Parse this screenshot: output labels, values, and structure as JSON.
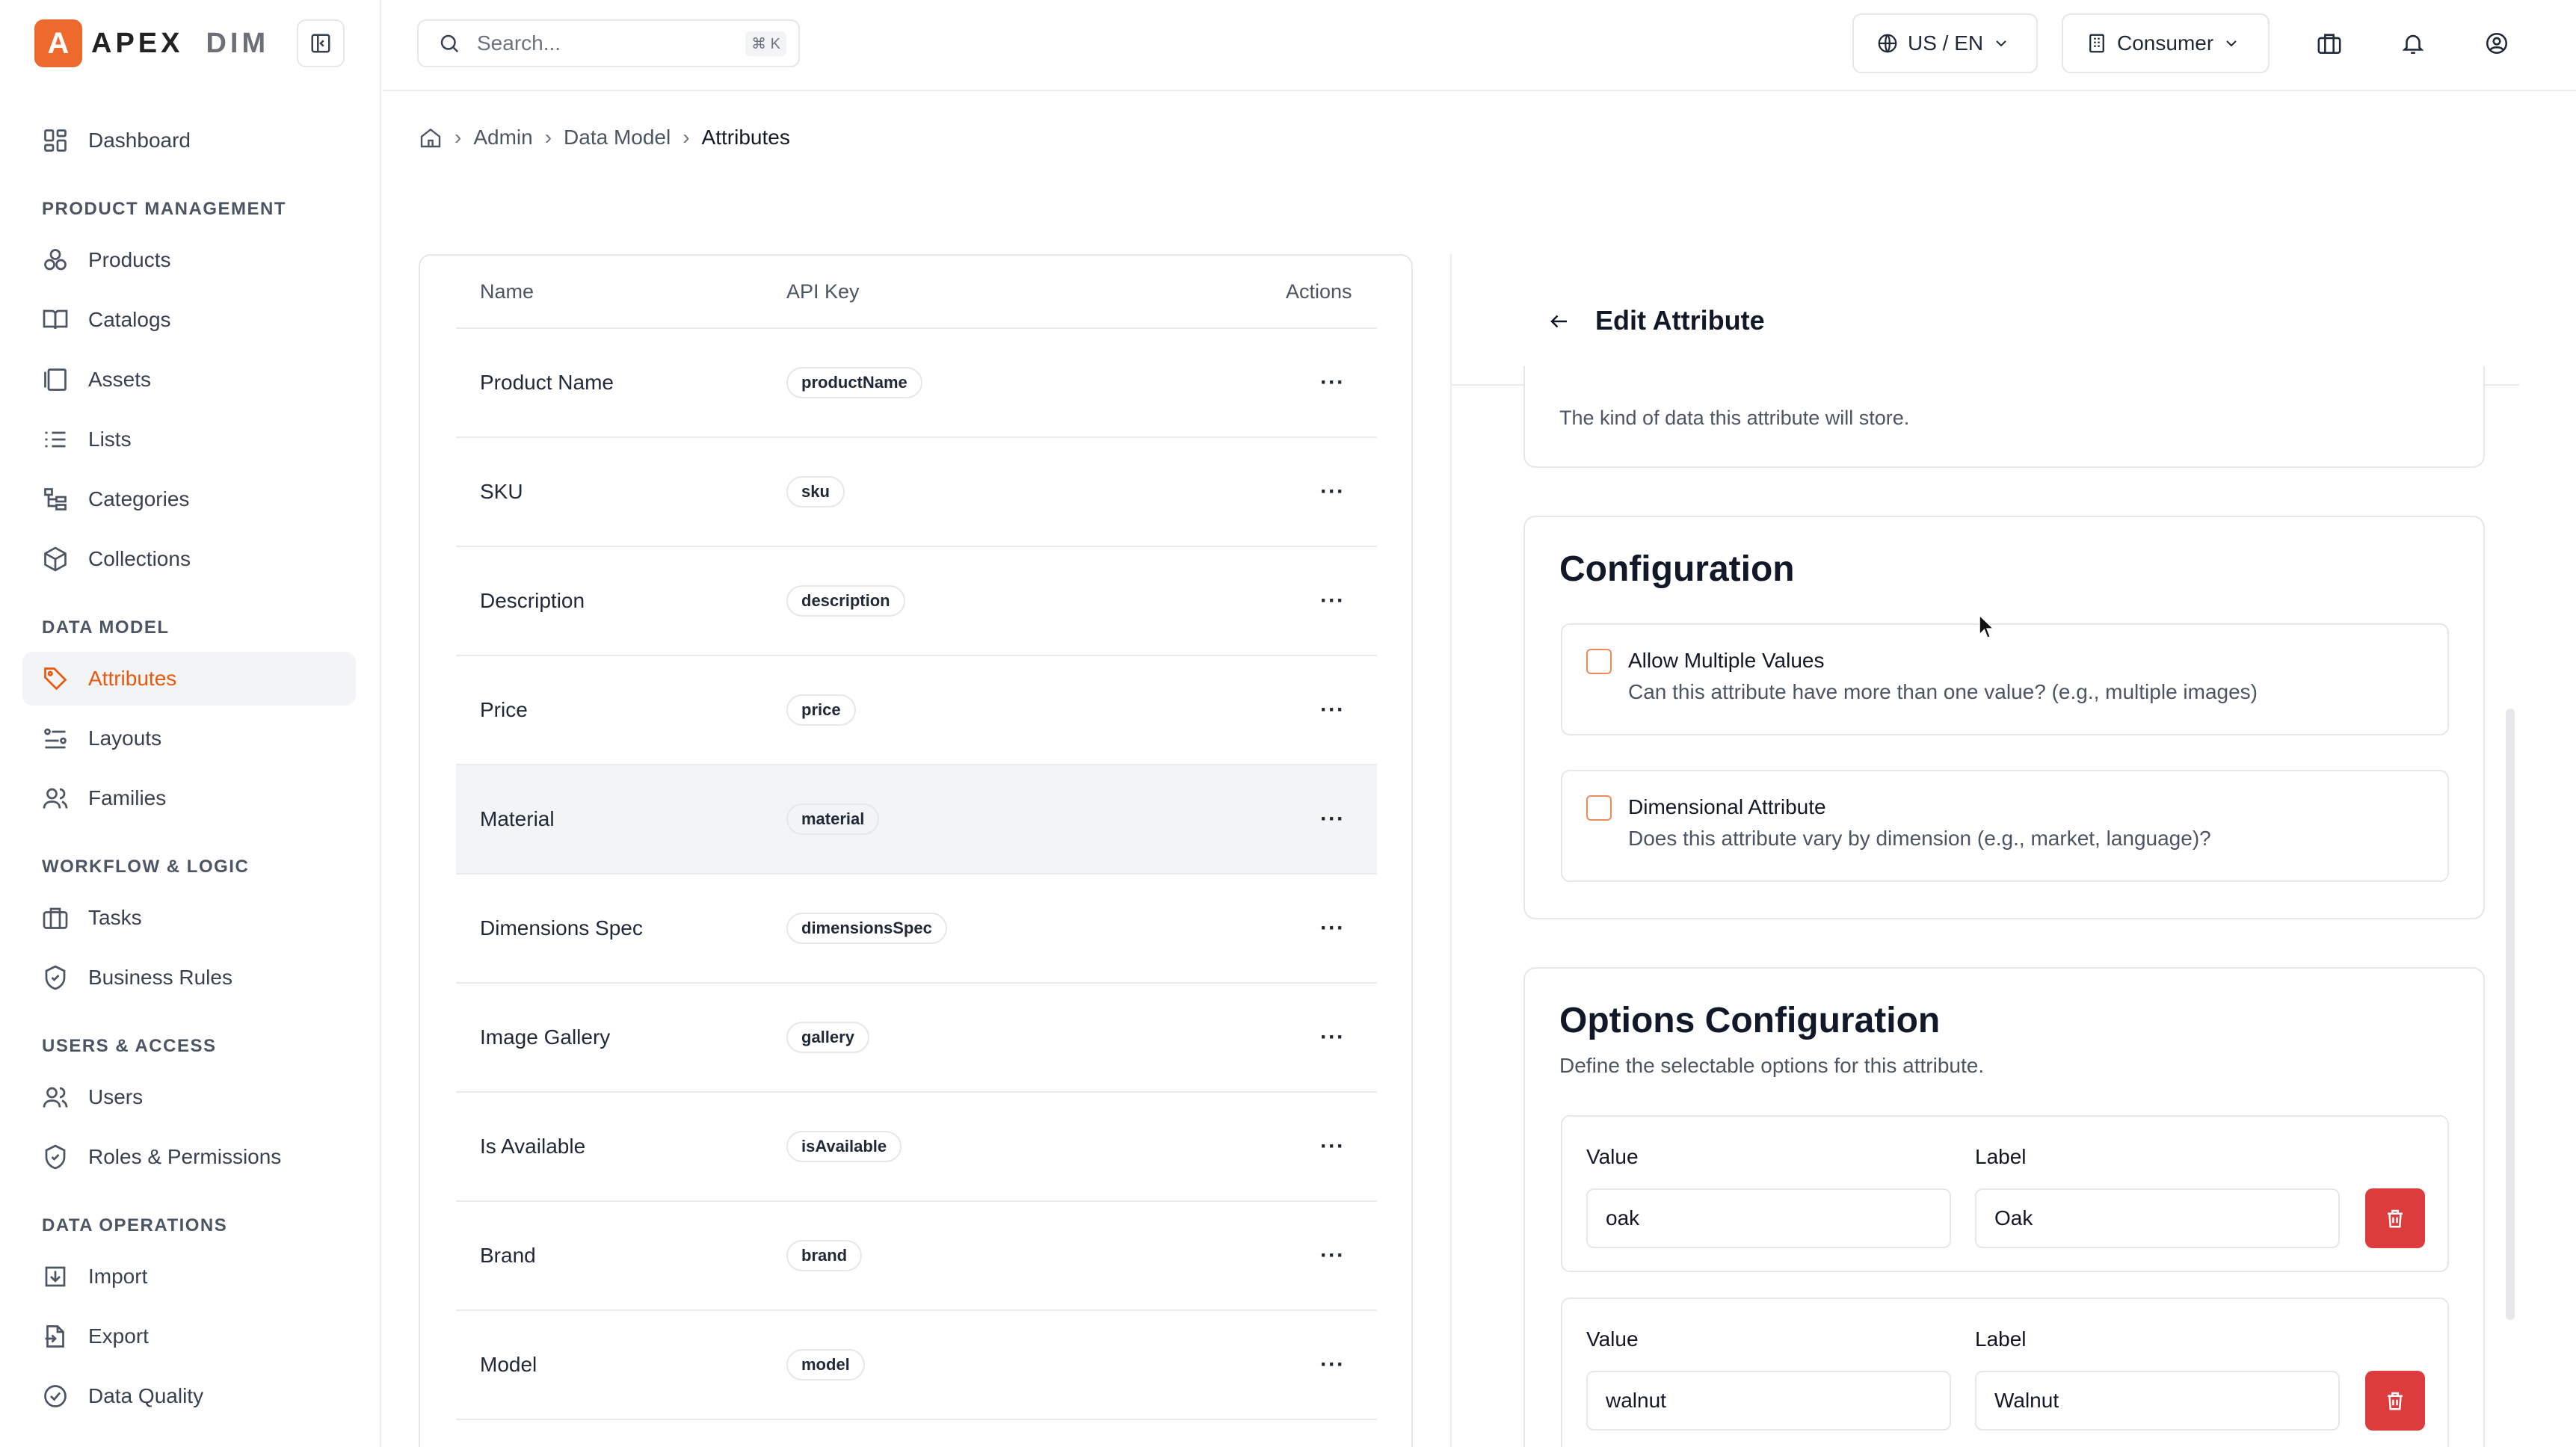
{
  "app": {
    "logo_letter": "A",
    "logo_text": "APEX",
    "logo_suffix": "DIM",
    "accent": "#ee6a2c"
  },
  "sidebar": {
    "dashboard": "Dashboard",
    "sections": [
      {
        "title": "PRODUCT MANAGEMENT",
        "items": [
          {
            "label": "Products",
            "icon": "products-icon"
          },
          {
            "label": "Catalogs",
            "icon": "book-icon"
          },
          {
            "label": "Assets",
            "icon": "assets-icon"
          },
          {
            "label": "Lists",
            "icon": "list-icon"
          },
          {
            "label": "Categories",
            "icon": "tree-icon"
          },
          {
            "label": "Collections",
            "icon": "box-icon"
          }
        ]
      },
      {
        "title": "DATA MODEL",
        "items": [
          {
            "label": "Attributes",
            "icon": "tag-icon",
            "active": true
          },
          {
            "label": "Layouts",
            "icon": "layout-icon"
          },
          {
            "label": "Families",
            "icon": "users-icon"
          }
        ]
      },
      {
        "title": "WORKFLOW & LOGIC",
        "items": [
          {
            "label": "Tasks",
            "icon": "briefcase-icon"
          },
          {
            "label": "Business Rules",
            "icon": "shield-icon"
          }
        ]
      },
      {
        "title": "USERS & ACCESS",
        "items": [
          {
            "label": "Users",
            "icon": "users-icon"
          },
          {
            "label": "Roles & Permissions",
            "icon": "shield-icon"
          }
        ]
      },
      {
        "title": "DATA OPERATIONS",
        "items": [
          {
            "label": "Import",
            "icon": "import-icon"
          },
          {
            "label": "Export",
            "icon": "export-icon"
          },
          {
            "label": "Data Quality",
            "icon": "check-circle-icon"
          }
        ]
      }
    ]
  },
  "topbar": {
    "search_placeholder": "Search...",
    "search_shortcut": "⌘ K",
    "locale": "US / EN",
    "channel": "Consumer"
  },
  "breadcrumb": {
    "items": [
      "Admin",
      "Data Model"
    ],
    "current": "Attributes"
  },
  "table": {
    "headers": {
      "name": "Name",
      "key": "API Key",
      "actions": "Actions"
    },
    "rows": [
      {
        "name": "Product Name",
        "key": "productName"
      },
      {
        "name": "SKU",
        "key": "sku"
      },
      {
        "name": "Description",
        "key": "description"
      },
      {
        "name": "Price",
        "key": "price"
      },
      {
        "name": "Material",
        "key": "material",
        "highlighted": true
      },
      {
        "name": "Dimensions Spec",
        "key": "dimensionsSpec"
      },
      {
        "name": "Image Gallery",
        "key": "gallery"
      },
      {
        "name": "Is Available",
        "key": "isAvailable"
      },
      {
        "name": "Brand",
        "key": "brand"
      },
      {
        "name": "Model",
        "key": "model"
      }
    ],
    "actions_glyph": "···"
  },
  "panel": {
    "title": "Edit Attribute",
    "type_help": "The kind of data this attribute will store.",
    "config": {
      "title": "Configuration",
      "multi_title": "Allow Multiple Values",
      "multi_desc": "Can this attribute have more than one value? (e.g., multiple images)",
      "dim_title": "Dimensional Attribute",
      "dim_desc": "Does this attribute vary by dimension (e.g., market, language)?"
    },
    "options": {
      "title": "Options Configuration",
      "desc": "Define the selectable options for this attribute.",
      "value_label": "Value",
      "label_label": "Label",
      "rows": [
        {
          "value": "oak",
          "label": "Oak"
        },
        {
          "value": "walnut",
          "label": "Walnut"
        }
      ]
    }
  }
}
